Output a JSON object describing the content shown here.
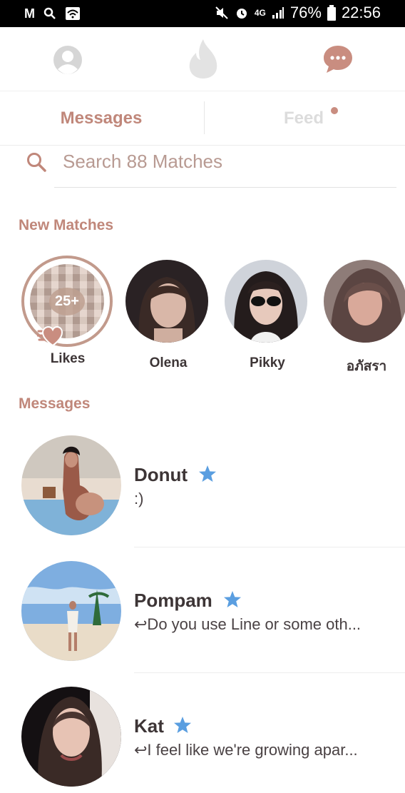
{
  "status_bar": {
    "left_icons": [
      "M",
      "Q",
      "wifi"
    ],
    "battery": "76%",
    "time": "22:56",
    "network": "4G"
  },
  "nav": {
    "profile_icon": "profile-icon",
    "flame_icon": "flame-icon",
    "chat_icon": "chat-bubble-icon"
  },
  "tabs": {
    "messages": "Messages",
    "feed": "Feed"
  },
  "search": {
    "placeholder": "Search 88 Matches"
  },
  "sections": {
    "new_matches": "New Matches",
    "messages": "Messages"
  },
  "new_matches": [
    {
      "name": "Likes",
      "count": "25+"
    },
    {
      "name": "Olena"
    },
    {
      "name": "Pikky"
    },
    {
      "name": "อภัสรา"
    }
  ],
  "messages": [
    {
      "name": "Donut",
      "preview": ":)",
      "replied": false,
      "super_like": true
    },
    {
      "name": "Pompam",
      "preview": "↩Do you use Line or some oth...",
      "replied": true,
      "super_like": true
    },
    {
      "name": "Kat",
      "preview": "↩I feel like we're growing apar...",
      "replied": true,
      "super_like": true
    }
  ],
  "colors": {
    "accent": "#c0877a",
    "star": "#5a9ee0",
    "text": "#3d3536"
  }
}
